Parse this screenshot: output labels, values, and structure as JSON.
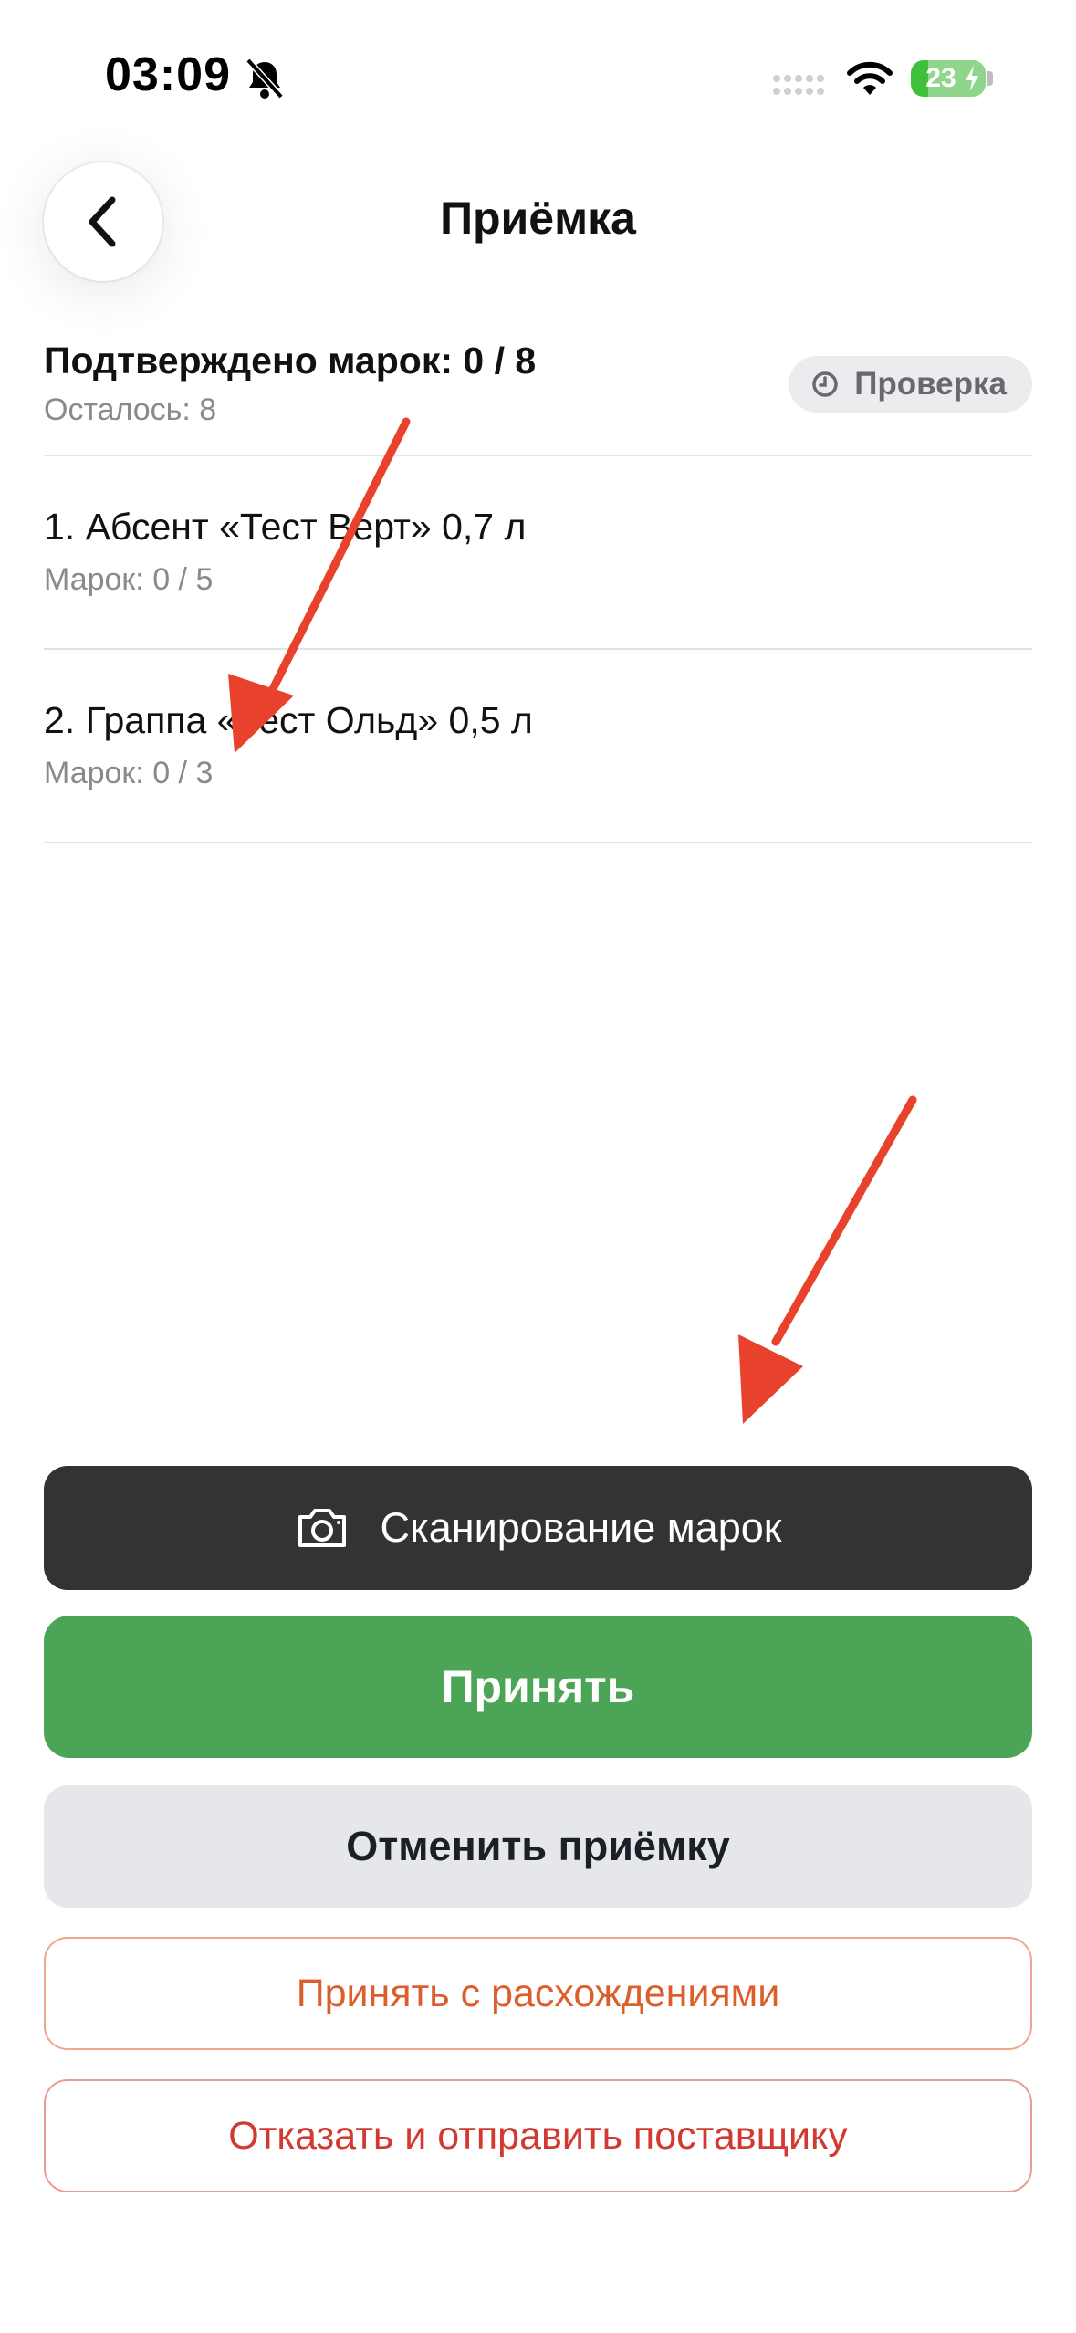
{
  "status_bar": {
    "time": "03:09",
    "battery": "23",
    "battery_level": 0.23,
    "icons": [
      "bell-slash-icon",
      "signal-icon",
      "wifi-icon",
      "battery-icon"
    ]
  },
  "header": {
    "title": "Приёмка",
    "back_icon": "chevron-left-icon"
  },
  "summary": {
    "title": "Подтверждено марок: 0 / 8",
    "remaining": "Осталось: 8",
    "badge": {
      "label": "Проверка",
      "icon": "clock-icon"
    }
  },
  "items": [
    {
      "name": "1. Абсент «Тест Верт» 0,7 л",
      "marks": "Марок: 0 / 5"
    },
    {
      "name": "2. Граппа «Тест Ольд» 0,5 л",
      "marks": "Марок: 0 / 3"
    }
  ],
  "actions": {
    "scan": {
      "label": "Сканирование марок",
      "icon": "camera-icon"
    },
    "accept": "Принять",
    "cancel": "Отменить приёмку",
    "accept_with_discrepancies": "Принять с расхождениями",
    "reject": "Отказать и отправить поставщику"
  },
  "colors": {
    "scan_button": "#333333",
    "accept_button": "#4ca556",
    "cancel_button": "#e6e7eb",
    "discrepancy_text": "#dc5e2c",
    "reject_text": "#d23a31",
    "annotation_arrow": "#e8412c"
  }
}
